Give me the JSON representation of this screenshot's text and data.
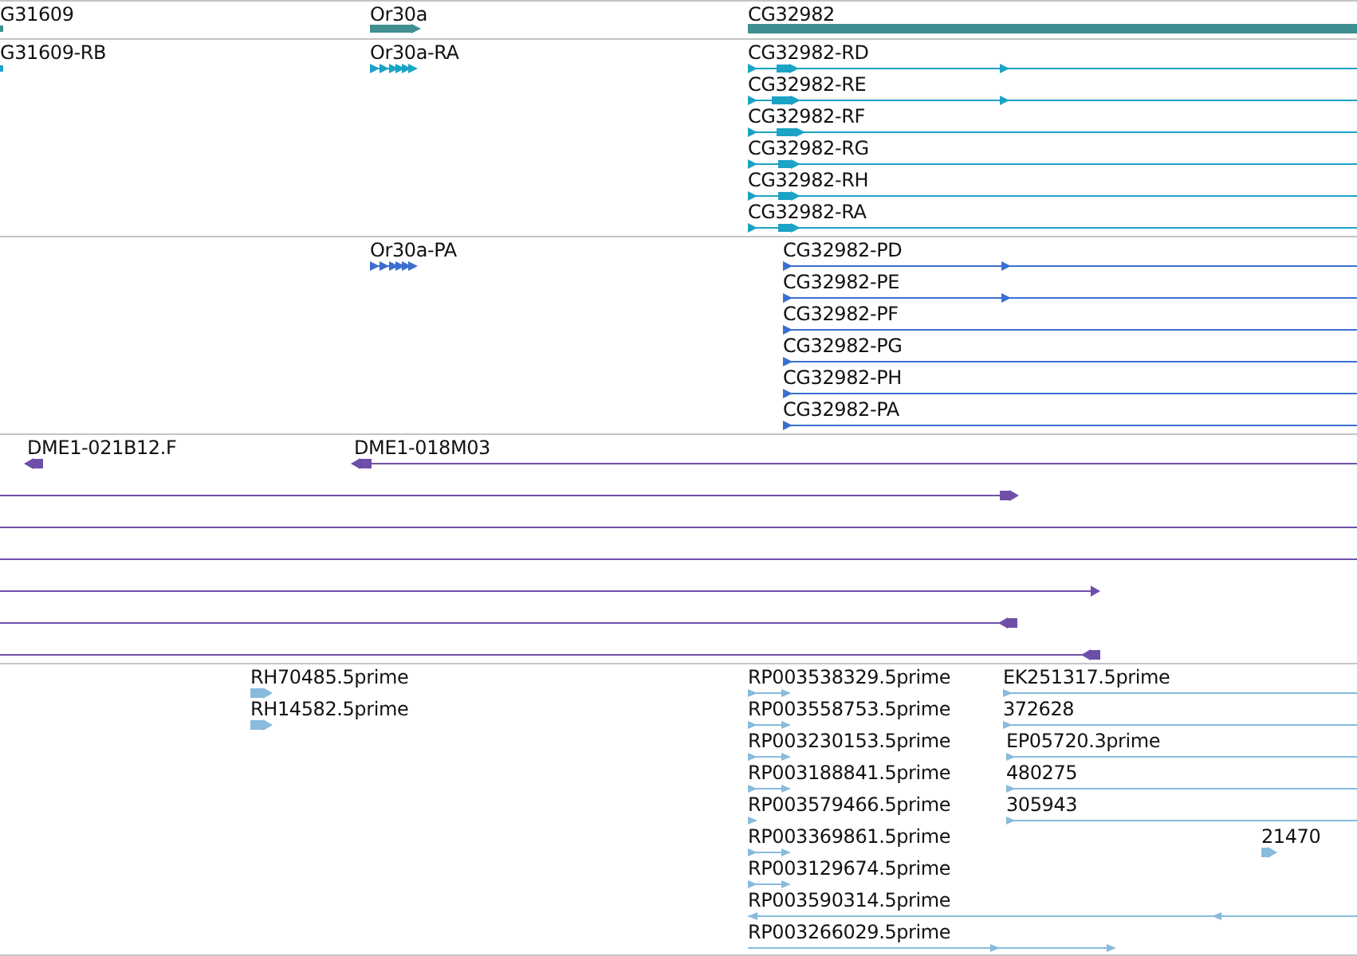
{
  "tracks": [
    {
      "kind": "gene",
      "color": "#3f8f91",
      "features": [
        {
          "label": "G31609"
        },
        {
          "label": "Or30a",
          "reverse": false
        },
        {
          "label": "CG32982"
        }
      ]
    },
    {
      "kind": "transcript",
      "color": "#1ba3c6",
      "features": [
        {
          "label": "G31609-RB"
        },
        {
          "label": "Or30a-RA",
          "reverse": false
        },
        {
          "label": "CG32982-RD",
          "reverse": false
        },
        {
          "label": "CG32982-RE",
          "reverse": false
        },
        {
          "label": "CG32982-RF",
          "reverse": false
        },
        {
          "label": "CG32982-RG",
          "reverse": false
        },
        {
          "label": "CG32982-RH",
          "reverse": false
        },
        {
          "label": "CG32982-RA",
          "reverse": false
        }
      ]
    },
    {
      "kind": "protein",
      "color": "#3a6fd0",
      "features": [
        {
          "label": "Or30a-PA",
          "reverse": false
        },
        {
          "label": "CG32982-PD",
          "reverse": false
        },
        {
          "label": "CG32982-PE",
          "reverse": false
        },
        {
          "label": "CG32982-PF",
          "reverse": false
        },
        {
          "label": "CG32982-PG",
          "reverse": false
        },
        {
          "label": "CG32982-PH",
          "reverse": false
        },
        {
          "label": "CG32982-PA",
          "reverse": false
        }
      ]
    },
    {
      "kind": "clone",
      "color": "#6e4fa8",
      "features": [
        {
          "kind": "arrow",
          "label": "DME1-021B12.F",
          "reverse": true
        },
        {
          "kind": "arrow",
          "label": "DME1-018M03",
          "reverse": true
        },
        {
          "kind": "arrow",
          "reverse": false
        },
        {
          "kind": "line"
        },
        {
          "kind": "line"
        },
        {
          "kind": "arrow",
          "reverse": false
        },
        {
          "kind": "arrow",
          "reverse": true
        },
        {
          "kind": "arrow",
          "reverse": true
        }
      ]
    },
    {
      "kind": "est",
      "color": "#88bbdd",
      "features": [
        {
          "label": "RH70485.5prime",
          "reverse": false
        },
        {
          "label": "RH14582.5prime",
          "reverse": false
        },
        {
          "label": "RP003538329.5prime",
          "reverse": false
        },
        {
          "label": "RP003558753.5prime",
          "reverse": false
        },
        {
          "label": "RP003230153.5prime",
          "reverse": false
        },
        {
          "label": "RP003188841.5prime",
          "reverse": false
        },
        {
          "label": "RP003579466.5prime",
          "reverse": false
        },
        {
          "label": "RP003369861.5prime",
          "reverse": false
        },
        {
          "label": "RP003129674.5prime",
          "reverse": false
        },
        {
          "label": "RP003590314.5prime",
          "reverse": true
        },
        {
          "label": "RP003266029.5prime",
          "reverse": false
        },
        {
          "label": "EK251317.5prime",
          "reverse": false
        },
        {
          "label": "372628",
          "reverse": false
        },
        {
          "label": "EP05720.3prime",
          "reverse": false
        },
        {
          "label": "480275",
          "reverse": false
        },
        {
          "label": "305943",
          "reverse": false
        },
        {
          "label": "21470",
          "reverse": false
        }
      ]
    }
  ]
}
